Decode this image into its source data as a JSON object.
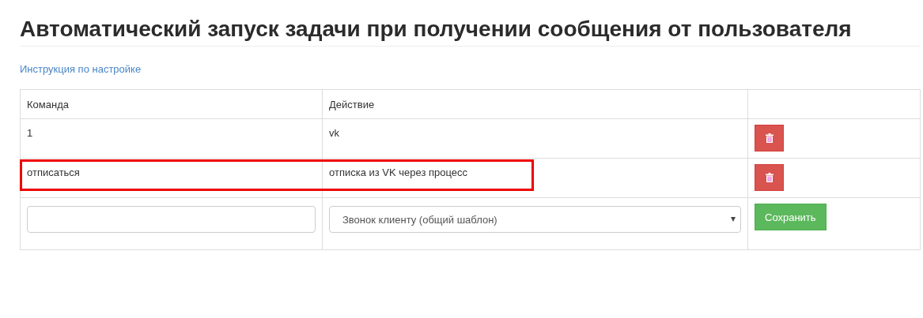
{
  "title": "Автоматический запуск задачи при получении сообщения от пользователя",
  "help_link": "Инструкция по настройке",
  "table": {
    "columns": [
      "Команда",
      "Действие"
    ],
    "rows": [
      {
        "command": "1",
        "action": "vk",
        "highlighted": false
      },
      {
        "command": "отписаться",
        "action": "отписка из VK через процесс",
        "highlighted": true
      }
    ],
    "new_row": {
      "action_select": "Звонок клиенту (общий шаблон)",
      "save_button": "Сохранить"
    }
  }
}
